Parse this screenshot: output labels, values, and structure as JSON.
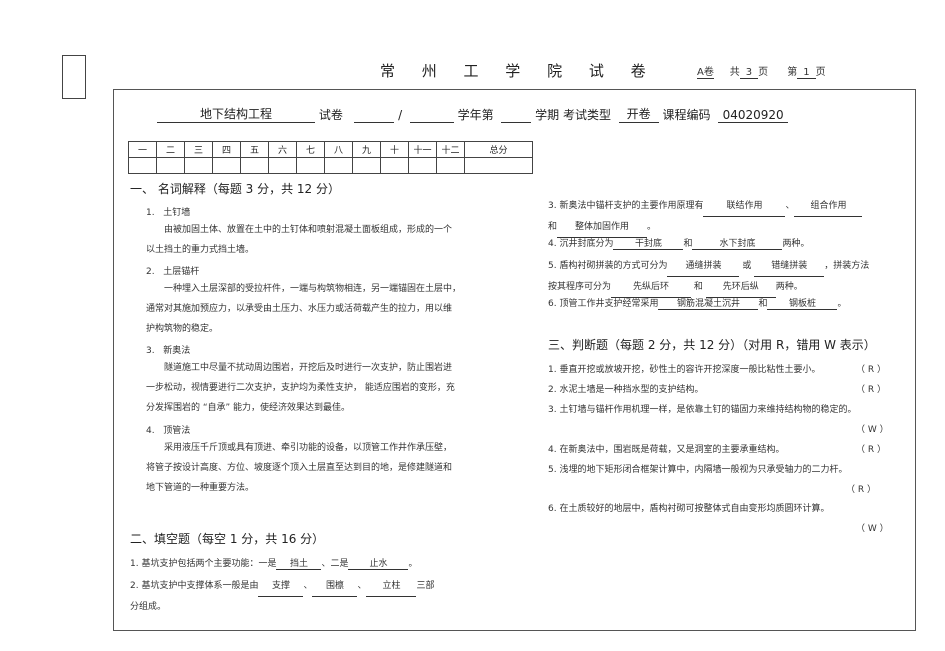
{
  "header": {
    "title": "常 州 工 学 院 试 卷",
    "paper_label": "A卷",
    "total_prefix": "共",
    "total_pages": "3",
    "pages_suffix": "页",
    "page_prefix": "第",
    "page_number": "1",
    "page_suffix": "页"
  },
  "course": {
    "course_name": "地下结构工程",
    "exam_label": "试卷",
    "slash": "/",
    "year_label": "学年第",
    "term_label": "学期",
    "exam_type_label": "考试类型",
    "exam_type": "开卷",
    "code_label": "课程编码",
    "course_code": "04020920"
  },
  "score_table": [
    "一",
    "二",
    "三",
    "四",
    "五",
    "六",
    "七",
    "八",
    "九",
    "十",
    "十一",
    "十二",
    "总分"
  ],
  "section1": {
    "title": "一、 名词解释（每题 3 分，共 12 分）",
    "items": [
      {
        "num": "1.",
        "term": "土钉墙",
        "lines": [
          "由被加固土体、放置在土中的土钉体和喷射混凝土面板组成，形成的一个",
          "以土挡土的重力式挡土墙。"
        ]
      },
      {
        "num": "2.",
        "term": "土层锚杆",
        "lines": [
          "一种埋入土层深部的受拉杆件，一端与构筑物相连，另一端锚固在土层中，",
          "通常对其施加预应力，以承受由土压力、水压力或活荷载产生的拉力，用以维",
          "护构筑物的稳定。"
        ]
      },
      {
        "num": "3.",
        "term": "新奥法",
        "lines": [
          "隧道施工中尽量不扰动周边围岩，开挖后及时进行一次支护，防止围岩进",
          "一步松动，视情要进行二次支护，支护均为柔性支护， 能适应围岩的变形，充",
          "分发挥围岩的 “自承” 能力，使经济效果达到最佳。"
        ]
      },
      {
        "num": "4.",
        "term": "顶管法",
        "lines": [
          "采用液压千斤顶或具有顶进、牵引功能的设备，以顶管工作井作承压壁，",
          "将管子按设计高度、方位、坡度逐个顶入土层直至达到目的地，是修建隧道和",
          "地下管道的一种重要方法。"
        ]
      }
    ]
  },
  "section2": {
    "title": "二、填空题（每空 1 分，共 16 分）",
    "q1": {
      "text_a": "1. 基坑支护包括两个主要功能：一是",
      "blank1": "挡土",
      "text_b": "、二是",
      "blank2": "止水",
      "text_c": "。"
    },
    "q2": {
      "text_a": "2. 基坑支护中支撑体系一般是由",
      "blank1": "支撑",
      "sep1": "、",
      "blank2": "围檩",
      "sep2": "、",
      "blank3": "立柱",
      "text_b": "三部",
      "text_c": "分组成。"
    },
    "q3": {
      "text_a": "3. 新奥法中锚杆支护的主要作用原理有",
      "blank1": "联结作用",
      "sep1": "、",
      "blank2": "组合作用",
      "text_b": "和",
      "blank3": "整体加固作用",
      "text_c": "。"
    },
    "q4": {
      "text_a": "4. 沉井封底分为",
      "blank1": "干封底",
      "mid": "和",
      "blank2": "水下封底",
      "text_b": "两种。"
    },
    "q5": {
      "text_a": "5. 盾构衬砌拼装的方式可分为",
      "blank1": "通缝拼装",
      "mid": "或",
      "blank2": "错缝拼装",
      "text_b": "，拼装方法",
      "text_c": "按其程序可分为",
      "blank3": "先纵后环",
      "mid2": "和",
      "blank4": "先环后纵",
      "text_d": "两种。"
    },
    "q6": {
      "text_a": "6. 顶管工作井支护经常采用",
      "blank1": "钢筋混凝土沉井",
      "mid": "和",
      "blank2": "钢板桩",
      "text_b": "。"
    }
  },
  "section3": {
    "title": "三、判断题（每题 2 分，共 12 分）（对用 R，错用 W 表示）",
    "items": [
      {
        "text": "1. 垂直开挖或放坡开挖，砂性土的容许开挖深度一般比粘性土要小。",
        "answer": "（ R ）"
      },
      {
        "text": "2. 水泥土墙是一种挡水型的支护结构。",
        "answer": "（ R ）"
      },
      {
        "text": "3. 土钉墙与锚杆作用机理一样，是依靠土钉的锚固力来维持结构物的稳定的。",
        "answer": "（ W ）"
      },
      {
        "text": "4. 在新奥法中，围岩既是荷载，又是洞室的主要承重结构。",
        "answer": "（ R ）"
      },
      {
        "text": "5. 浅埋的地下矩形闭合框架计算中，内隔墙一般视为只承受轴力的二力杆。",
        "answer": "（ R ）"
      },
      {
        "text": "6. 在土质较好的地层中，盾构衬砌可按整体式自由变形均质圆环计算。",
        "answer": "（ W ）"
      }
    ]
  }
}
